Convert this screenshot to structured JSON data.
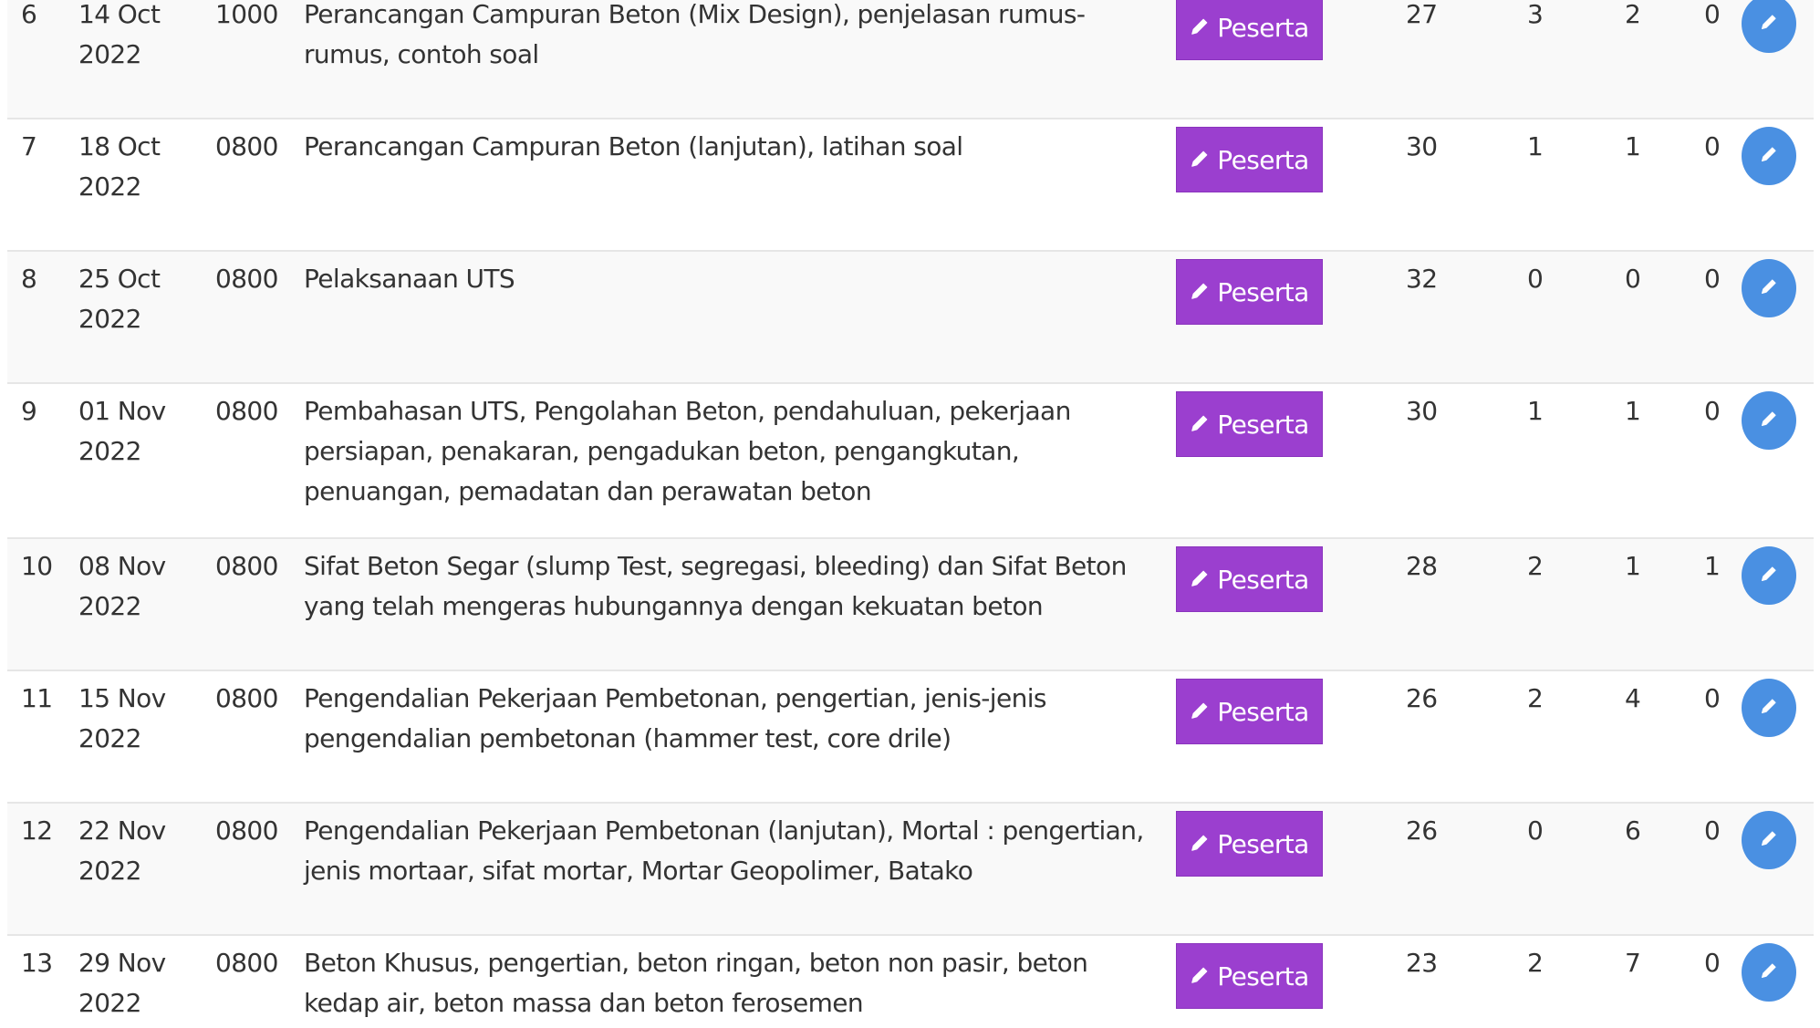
{
  "table": {
    "rows": [
      {
        "no": "6",
        "date": "14 Oct\n2022",
        "time": "1000",
        "topic": "Perancangan Campuran Beton (Mix Design), penjelasan rumus-rumus, contoh soal",
        "button_label": "Peserta",
        "n1": "27",
        "n2": "3",
        "n3": "2",
        "n4": "0"
      },
      {
        "no": "7",
        "date": "18 Oct\n2022",
        "time": "0800",
        "topic": "Perancangan Campuran Beton (lanjutan), latihan soal",
        "button_label": "Peserta",
        "n1": "30",
        "n2": "1",
        "n3": "1",
        "n4": "0"
      },
      {
        "no": "8",
        "date": "25 Oct\n2022",
        "time": "0800",
        "topic": "Pelaksanaan UTS",
        "button_label": "Peserta",
        "n1": "32",
        "n2": "0",
        "n3": "0",
        "n4": "0"
      },
      {
        "no": "9",
        "date": "01 Nov\n2022",
        "time": "0800",
        "topic": "Pembahasan UTS, Pengolahan Beton, pendahuluan, pekerjaan persiapan, penakaran, pengadukan beton, pengangkutan, penuangan, pemadatan dan perawatan beton",
        "button_label": "Peserta",
        "n1": "30",
        "n2": "1",
        "n3": "1",
        "n4": "0"
      },
      {
        "no": "10",
        "date": "08 Nov\n2022",
        "time": "0800",
        "topic": "Sifat Beton Segar (slump Test, segregasi, bleeding) dan Sifat Beton yang telah mengeras hubungannya dengan kekuatan beton",
        "button_label": "Peserta",
        "n1": "28",
        "n2": "2",
        "n3": "1",
        "n4": "1"
      },
      {
        "no": "11",
        "date": "15 Nov\n2022",
        "time": "0800",
        "topic": "Pengendalian Pekerjaan Pembetonan, pengertian, jenis-jenis pengendalian pembetonan (hammer test, core drile)",
        "button_label": "Peserta",
        "n1": "26",
        "n2": "2",
        "n3": "4",
        "n4": "0"
      },
      {
        "no": "12",
        "date": "22 Nov\n2022",
        "time": "0800",
        "topic": "Pengendalian Pekerjaan Pembetonan (lanjutan), Mortal : pengertian, jenis mortaar, sifat mortar, Mortar Geopolimer, Batako",
        "button_label": "Peserta",
        "n1": "26",
        "n2": "0",
        "n3": "6",
        "n4": "0"
      },
      {
        "no": "13",
        "date": "29 Nov\n2022",
        "time": "0800",
        "topic": "Beton Khusus, pengertian, beton ringan, beton non pasir, beton kedap air, beton massa dan beton ferosemen",
        "button_label": "Peserta",
        "n1": "23",
        "n2": "2",
        "n3": "7",
        "n4": "0"
      }
    ]
  },
  "icons": {
    "peserta": "pencil-icon",
    "edit": "pencil-icon"
  },
  "colors": {
    "peserta_button": "#9b3fcf",
    "edit_button": "#4a90e2",
    "row_stripe": "#f9f9f9",
    "row_divider": "#e6e6e6",
    "text": "#333333"
  }
}
